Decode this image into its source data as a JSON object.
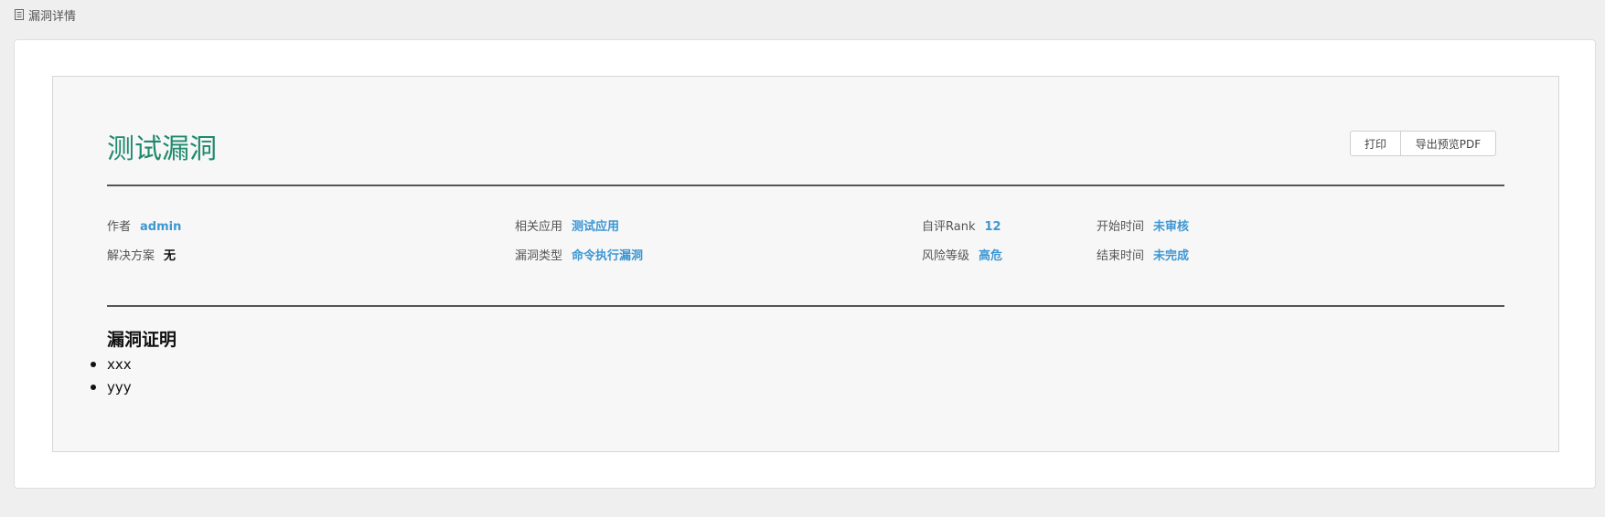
{
  "header": {
    "title": "漏洞详情",
    "icon": "document-icon"
  },
  "vuln": {
    "title": "测试漏洞"
  },
  "toolbar": {
    "print_label": "打印",
    "export_label": "导出预览PDF"
  },
  "meta": {
    "author_label": "作者",
    "author_value": "admin",
    "solution_label": "解决方案",
    "solution_value": "无",
    "app_label": "相关应用",
    "app_value": "测试应用",
    "type_label": "漏洞类型",
    "type_value": "命令执行漏洞",
    "rank_label": "自评Rank",
    "rank_value": "12",
    "risk_label": "风险等级",
    "risk_value": "高危",
    "start_label": "开始时间",
    "start_value": "未审核",
    "end_label": "结束时间",
    "end_value": "未完成"
  },
  "proof": {
    "title": "漏洞证明",
    "items": [
      "xxx",
      "yyy"
    ]
  },
  "colors": {
    "title": "#1e8a6c",
    "value_link": "#3d97d3",
    "background": "#efefef",
    "panel": "#f7f7f7"
  }
}
